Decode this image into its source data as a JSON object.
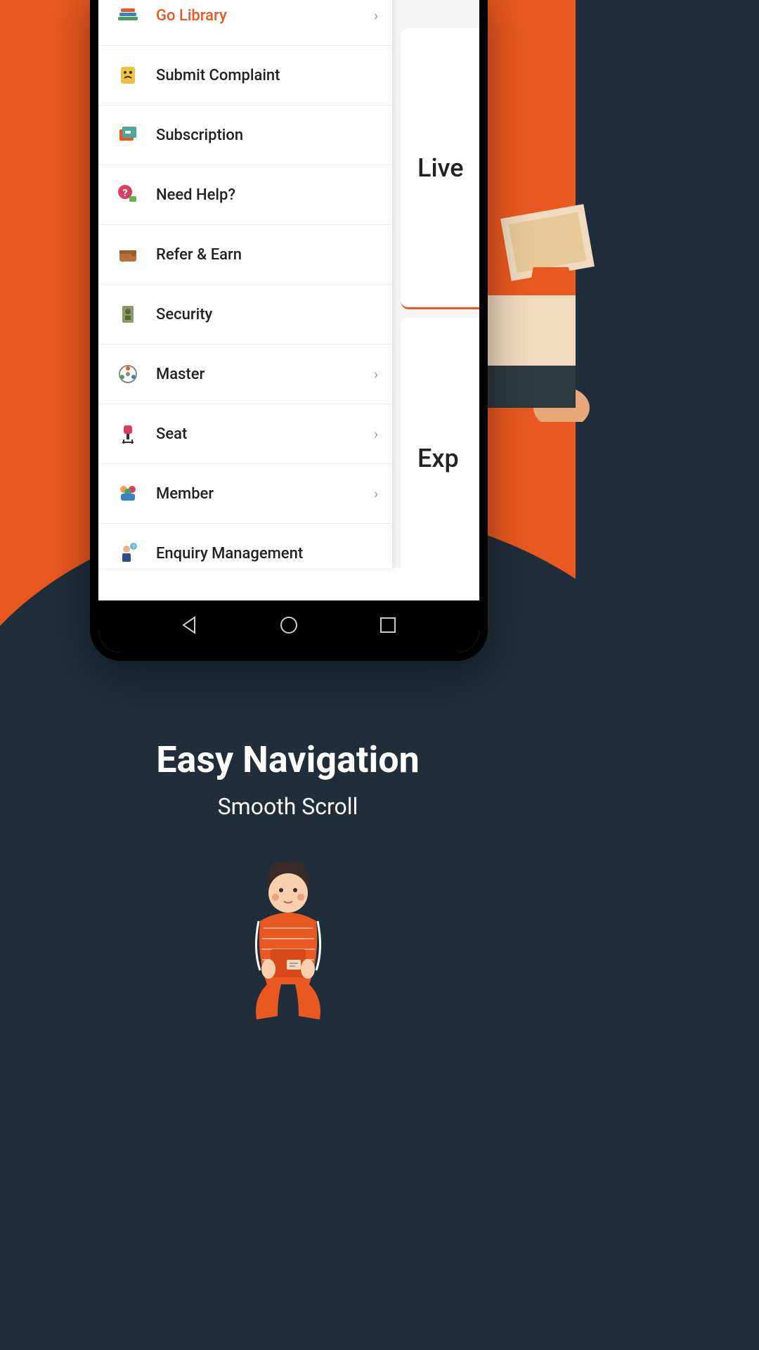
{
  "menu": [
    {
      "label": "Go Library",
      "icon": "books-icon",
      "chevron": true,
      "highlight": true
    },
    {
      "label": "Submit Complaint",
      "icon": "complaint-icon",
      "chevron": false
    },
    {
      "label": "Subscription",
      "icon": "wallet-icon",
      "chevron": false
    },
    {
      "label": "Need Help?",
      "icon": "help-icon",
      "chevron": false
    },
    {
      "label": "Refer & Earn",
      "icon": "refer-icon",
      "chevron": false
    },
    {
      "label": "Security",
      "icon": "security-icon",
      "chevron": false
    },
    {
      "label": "Master",
      "icon": "master-icon",
      "chevron": true
    },
    {
      "label": "Seat",
      "icon": "seat-icon",
      "chevron": true
    },
    {
      "label": "Member",
      "icon": "member-icon",
      "chevron": true
    },
    {
      "label": "Enquiry Management",
      "icon": "enquiry-icon",
      "chevron": false
    }
  ],
  "cards": {
    "live": "Live",
    "exp": "Exp"
  },
  "promo": {
    "title": "Easy Navigation",
    "subtitle": "Smooth Scroll"
  },
  "chevron_glyph": "›"
}
